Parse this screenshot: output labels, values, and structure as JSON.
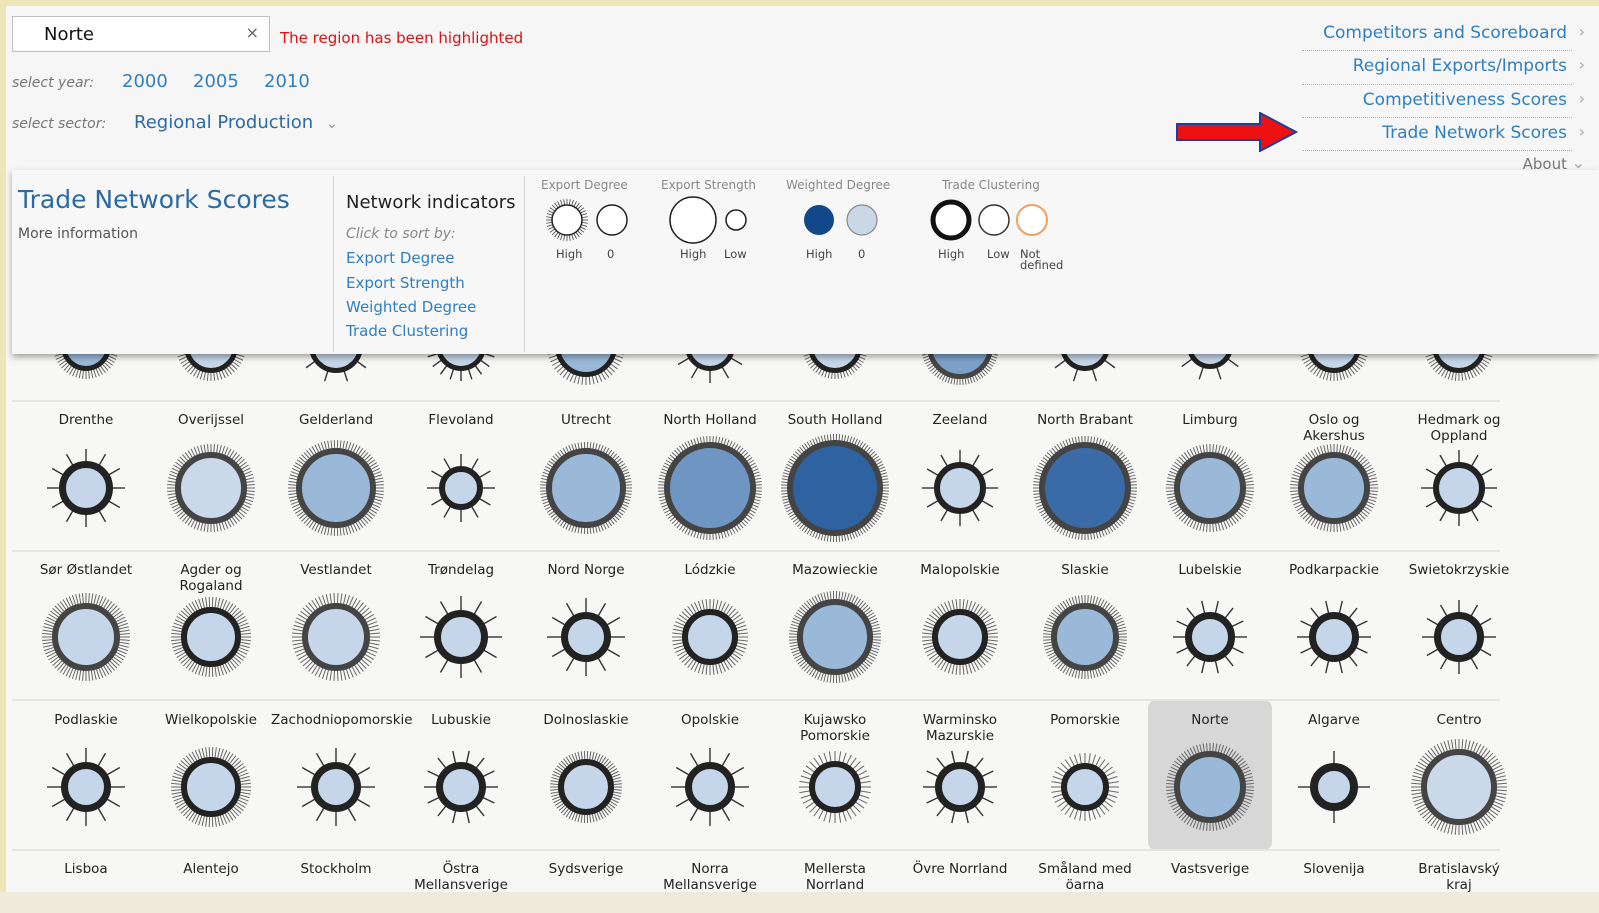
{
  "search": {
    "value": "Norte",
    "clear": "×",
    "status": "The region has been highlighted"
  },
  "year": {
    "label": "select year:",
    "options": [
      "2000",
      "2005",
      "2010"
    ]
  },
  "sector": {
    "label": "select sector:",
    "value": "Regional Production",
    "chevron": "⌄"
  },
  "nav": {
    "items": [
      "Competitors and Scoreboard",
      "Regional Exports/Imports",
      "Competitiveness Scores",
      "Trade Network Scores"
    ],
    "chevron": "›",
    "about": "About",
    "about_chevron": "⌄"
  },
  "panel": {
    "title": "Trade Network Scores",
    "more_info": "More information",
    "indicators_title": "Network indicators",
    "sort_hint": "Click to sort by:",
    "sort_links": [
      "Export Degree",
      "Export Strength",
      "Weighted Degree",
      "Trade Clustering"
    ]
  },
  "legend": {
    "export_degree": {
      "title": "Export Degree",
      "high": "High",
      "zero": "0"
    },
    "export_strength": {
      "title": "Export Strength",
      "high": "High",
      "low": "Low"
    },
    "weighted_degree": {
      "title": "Weighted Degree",
      "high": "High",
      "zero": "0"
    },
    "trade_clustering": {
      "title": "Trade Clustering",
      "high": "High",
      "low": "Low",
      "not_defined_1": "Not",
      "not_defined_2": "defined"
    }
  },
  "colors": {
    "accent": "#2f7fc1",
    "status": "#e01010",
    "ring": "#222222",
    "fill_light": "#cfdceb",
    "fill_dark": "#2e5f9a"
  },
  "regions": {
    "row1": [
      "Drenthe",
      "Overijssel",
      "Gelderland",
      "Flevoland",
      "Utrecht",
      "North Holland",
      "South Holland",
      "Zeeland",
      "North Brabant",
      "Limburg",
      [
        "Oslo og",
        "Akershus"
      ],
      [
        "Hedmark og",
        "Oppland"
      ]
    ],
    "row2": [
      "Sør Østlandet",
      [
        "Agder og",
        "Rogaland"
      ],
      "Vestlandet",
      "Trøndelag",
      "Nord Norge",
      "Lódzkie",
      "Mazowieckie",
      "Malopolskie",
      "Slaskie",
      "Lubelskie",
      "Podkarpackie",
      "Swietokrzyskie"
    ],
    "row3": [
      "Podlaskie",
      "Wielkopolskie",
      "Zachodniopomorskie",
      "Lubuskie",
      "Dolnoslaskie",
      "Opolskie",
      [
        "Kujawsko",
        "Pomorskie"
      ],
      [
        "Warminsko",
        "Mazurskie"
      ],
      "Pomorskie",
      "Norte",
      "Algarve",
      "Centro"
    ],
    "row4": [
      "Lisboa",
      "Alentejo",
      "Stockholm",
      [
        "Östra",
        "Mellansverige"
      ],
      "Sydsverige",
      [
        "Norra",
        "Mellansverige"
      ],
      [
        "Mellersta",
        "Norrland"
      ],
      "Övre Norrland",
      [
        "Småland med",
        "öarna"
      ],
      "Vastsverige",
      "Slovenija",
      [
        "Bratislavský",
        "kraj"
      ]
    ]
  },
  "highlighted_region": "Norte"
}
